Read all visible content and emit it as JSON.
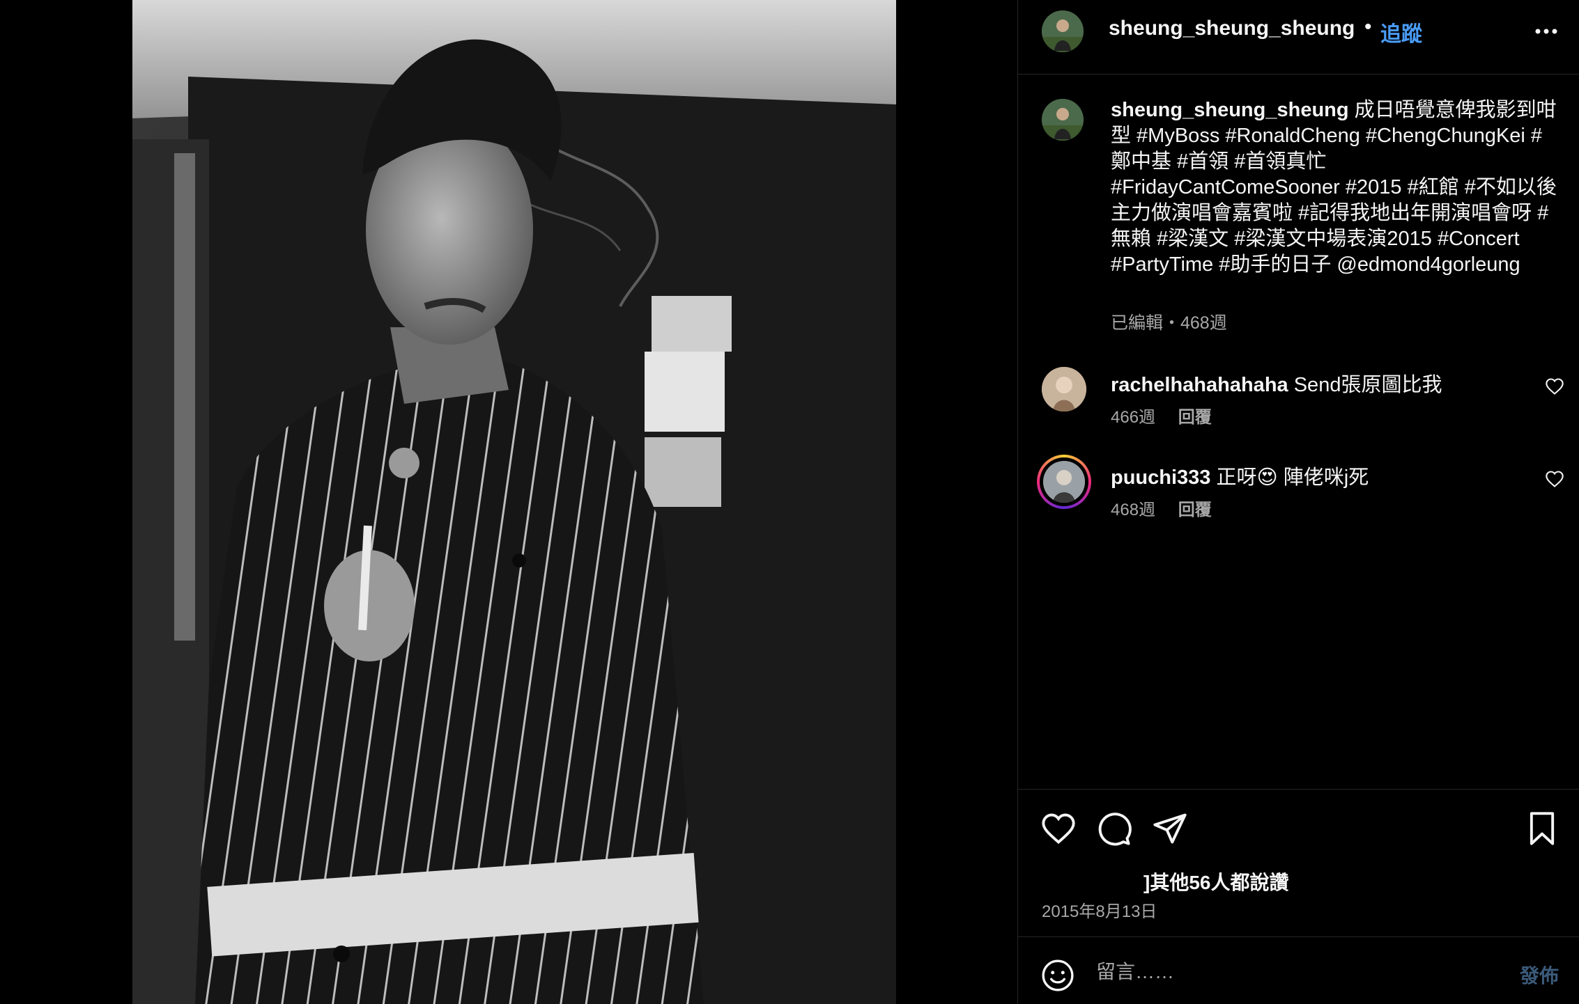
{
  "post": {
    "username": "sheung_sheung_sheung",
    "dot": "•",
    "follow_label": "追蹤",
    "more_icon": "more-horizontal-icon"
  },
  "caption": {
    "username": "sheung_sheung_sheung",
    "text": "成日唔覺意俾我影到咁型 #MyBoss #RonaldCheng #ChengChungKei #鄭中基 #首領 #首領真忙 #FridayCantComeSooner #2015 #紅館 #不如以後主力做演唱會嘉賓啦 #記得我地出年開演唱會呀 #無賴 #梁漢文 #梁漢文中場表演2015 #Concert #PartyTime #助手的日子 @edmond4gorleung",
    "meta": "已編輯・468週"
  },
  "comments": [
    {
      "username": "rachelhahahahaha",
      "text": "Send張原圖比我",
      "age": "466週",
      "reply_label": "回覆"
    },
    {
      "username": "puuchi333",
      "text": "正呀😍 陣佬咪j死",
      "age": "468週",
      "reply_label": "回覆"
    }
  ],
  "actions": {
    "icons": [
      "heart-icon",
      "comment-icon",
      "share-icon",
      "bookmark-icon"
    ],
    "likes_text": "]其他56人都說讚",
    "date": "2015年8月13日"
  },
  "composer": {
    "placeholder": "留言……",
    "post_label": "發佈"
  },
  "colors": {
    "accent": "#4a9cf8",
    "muted": "#a8a8a8",
    "divider": "#262626",
    "post_disabled": "#3b5a7a"
  }
}
